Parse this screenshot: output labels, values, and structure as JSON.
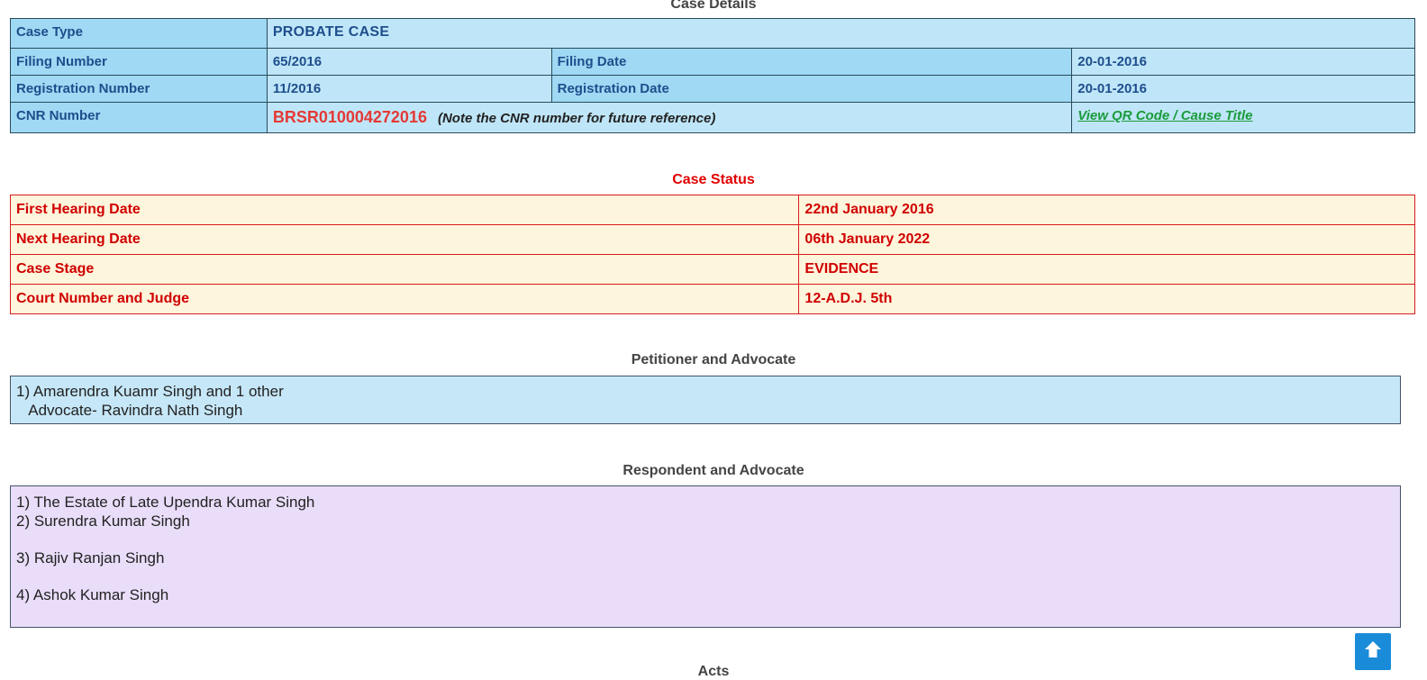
{
  "case_details": {
    "title": "Case Details",
    "case_type_label": "Case Type",
    "case_type_value": "PROBATE CASE",
    "filing_number_label": "Filing Number",
    "filing_number_value": "65/2016",
    "filing_date_label": "Filing Date",
    "filing_date_value": "20-01-2016",
    "registration_number_label": "Registration Number",
    "registration_number_value": "11/2016",
    "registration_date_label": "Registration Date",
    "registration_date_value": "20-01-2016",
    "cnr_label": "CNR Number",
    "cnr_value": "BRSR010004272016",
    "cnr_note": "(Note the CNR number for future reference)",
    "qr_link": "View QR Code / Cause Title"
  },
  "case_status": {
    "title": "Case Status",
    "rows": [
      {
        "label": "First Hearing Date",
        "value": "22nd January 2016"
      },
      {
        "label": "Next Hearing Date",
        "value": "06th January 2022"
      },
      {
        "label": "Case Stage",
        "value": "EVIDENCE"
      },
      {
        "label": "Court Number and Judge",
        "value": "12-A.D.J. 5th"
      }
    ]
  },
  "petitioner": {
    "title": "Petitioner and Advocate",
    "line1": "1) Amarendra Kuamr Singh and 1 other",
    "line2": "   Advocate- Ravindra Nath Singh"
  },
  "respondent": {
    "title": "Respondent and Advocate",
    "items": [
      "1) The Estate of Late Upendra Kumar Singh",
      "2) Surendra Kumar Singh",
      "3) Rajiv Ranjan Singh",
      "4) Ashok Kumar Singh"
    ]
  },
  "acts": {
    "title": "Acts"
  },
  "icons": {
    "scroll_top": "arrow-up-icon"
  },
  "colors": {
    "details_label_bg": "#9fd9f4",
    "details_value_bg": "#bfe6f8",
    "status_bg": "#fdf5dc",
    "status_text": "#d00000",
    "cnr_red": "#e53935",
    "link_green": "#1a9b3a",
    "petitioner_bg": "#c6e7f8",
    "respondent_bg": "#e9ddf9",
    "scroll_button": "#1a8bd8"
  }
}
